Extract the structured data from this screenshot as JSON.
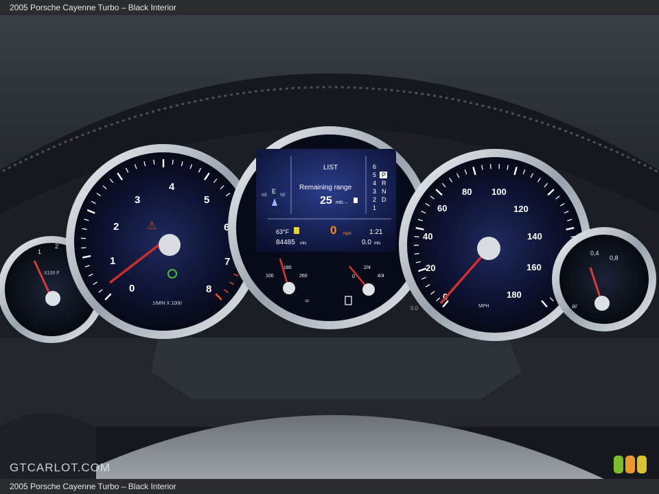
{
  "caption": "2005 Porsche Cayenne Turbo – Black Interior",
  "watermark": "GTCARLOT.COM",
  "brand_colors": {
    "green": "#7bbd2e",
    "orange": "#e89a2a",
    "yellow": "#d8c234"
  },
  "tachometer": {
    "numbers": [
      "0",
      "1",
      "2",
      "3",
      "4",
      "5",
      "6",
      "7",
      "8"
    ],
    "unit": "1/MIN X 1000",
    "needle_value": 0.4
  },
  "speedometer": {
    "numbers": [
      "0",
      "20",
      "40",
      "60",
      "80",
      "100",
      "120",
      "140",
      "160",
      "180"
    ],
    "unit": "MPH",
    "needle_value": 0
  },
  "left_gauge": {
    "labels": [
      "1",
      "2"
    ],
    "unit": "X100 F"
  },
  "right_gauge": {
    "labels": [
      "0,4",
      "0,8"
    ],
    "unit": "ar"
  },
  "center_display": {
    "menu_title": "LIST",
    "compass_left": "NE",
    "compass_main": "E",
    "compass_right": "SE",
    "range_label": "Remaining range",
    "range_value": "25",
    "range_unit": "mls→",
    "gears": [
      "6",
      "5",
      "4",
      "3",
      "2",
      "1"
    ],
    "gear_letters": [
      "P",
      "R",
      "N",
      "D"
    ],
    "temperature": "63°F",
    "odometer": "84485",
    "odometer_unit": "mls",
    "speed_value": "0",
    "speed_unit": "mph",
    "clock": "1:21",
    "trip": "0.0",
    "trip_unit": "mls"
  },
  "oil_temp_gauge": {
    "labels": [
      "100",
      "180",
      "260"
    ]
  },
  "fuel_gauge": {
    "labels": [
      "0",
      "2/4",
      "4/4"
    ]
  },
  "misc_label": "0.0"
}
